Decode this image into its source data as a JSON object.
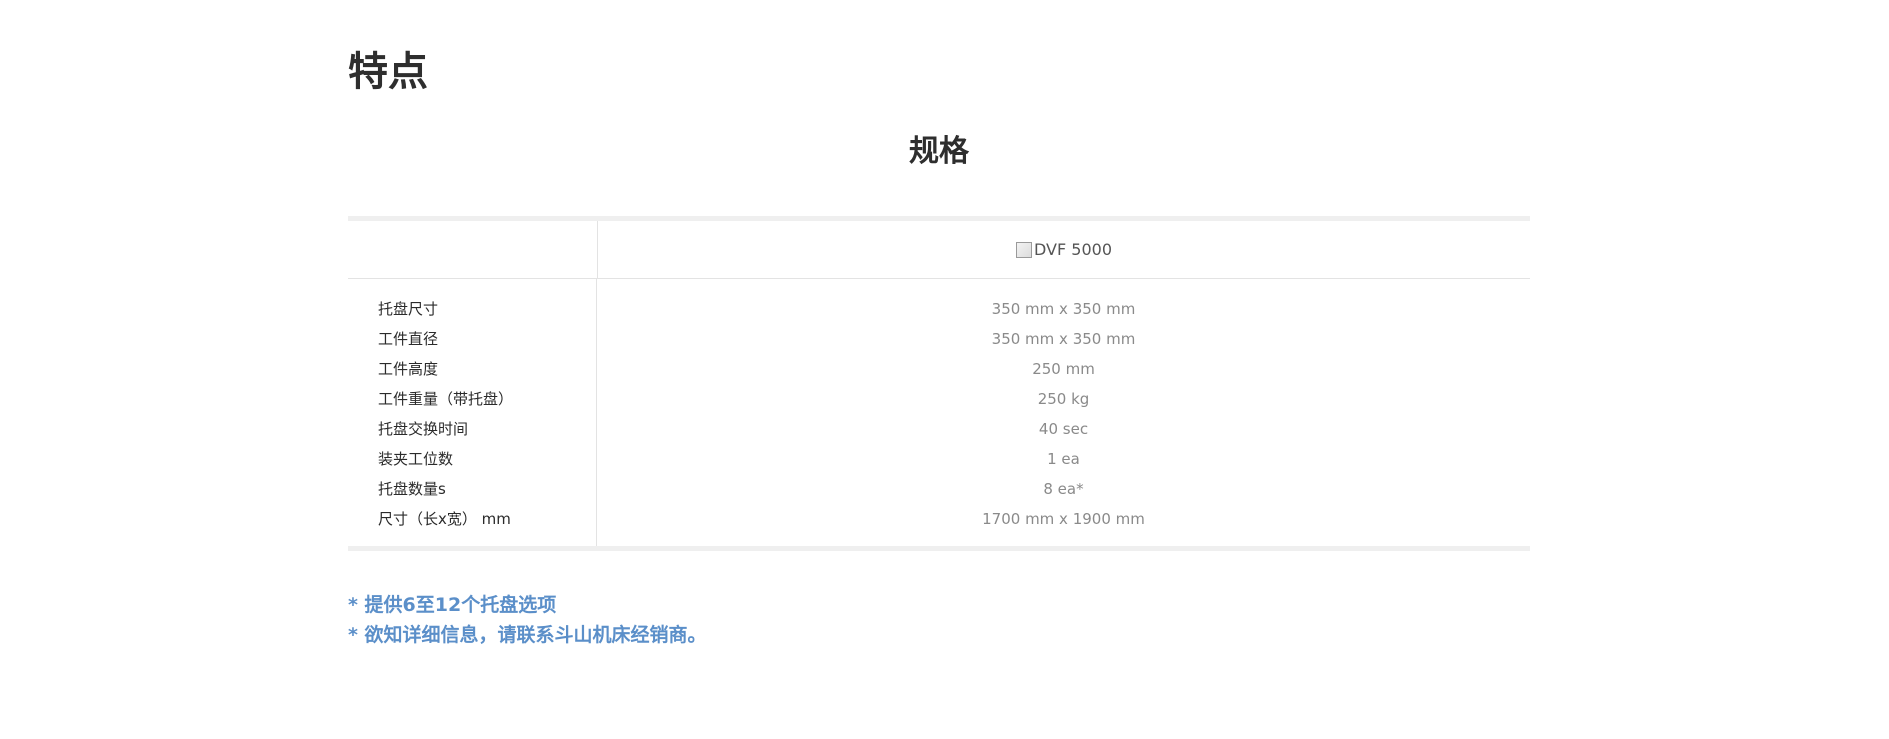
{
  "features": {
    "title": "特点"
  },
  "specs": {
    "title": "规格",
    "model": {
      "image_alt": "DVF 5000",
      "image_icon": "broken-image-icon"
    },
    "rows": [
      {
        "label": "托盘尺寸",
        "value": "350 mm x 350 mm"
      },
      {
        "label": "工件直径",
        "value": "350 mm x 350 mm"
      },
      {
        "label": "工件高度",
        "value": "250 mm"
      },
      {
        "label": "工件重量（带托盘）",
        "value": "250 kg"
      },
      {
        "label": "托盘交换时间",
        "value": "40 sec"
      },
      {
        "label": "装夹工位数",
        "value": "1 ea"
      },
      {
        "label": "托盘数量s",
        "value": "8 ea*"
      },
      {
        "label": "尺寸（长x宽） mm",
        "value": "1700 mm x 1900 mm"
      }
    ]
  },
  "notes": [
    "* 提供6至12个托盘选项",
    "* 欲知详细信息，请联系斗山机床经销商。"
  ],
  "colors": {
    "note_text": "#5b8fc9",
    "heading_text": "#2e2e2e",
    "value_text": "#8a8a8a",
    "table_rule": "#efefef"
  }
}
